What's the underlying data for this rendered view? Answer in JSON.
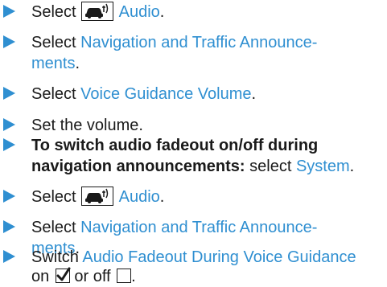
{
  "steps": [
    {
      "select": "Select",
      "link": "Audio",
      "end": "."
    },
    {
      "select": "Select",
      "link1": "Navigation and Traffic Announce-",
      "link2": "ments",
      "end": "."
    },
    {
      "select": "Select",
      "link": "Voice Guidance Volume",
      "end": "."
    },
    {
      "text": "Set the volume."
    },
    {
      "bold1": "To switch audio fadeout on/off during",
      "bold2": "navigation announcements:",
      "text": "select",
      "link": "System",
      "end": "."
    },
    {
      "select": "Select",
      "link": "Audio",
      "end": "."
    },
    {
      "select": "Select",
      "link1": "Navigation and Traffic Announce-",
      "link2": "ments",
      "end": "."
    },
    {
      "text": "Switch",
      "link": "Audio Fadeout During Voice Guidance",
      "on": "on",
      "or_off": "or off",
      "end": "."
    }
  ],
  "icons": {
    "audio": "car-audio-icon",
    "checked": "checkbox-checked-icon",
    "unchecked": "checkbox-unchecked-icon"
  },
  "colors": {
    "link": "#2f8fd1",
    "arrow": "#2f8fd1",
    "text": "#1a1a1a"
  }
}
